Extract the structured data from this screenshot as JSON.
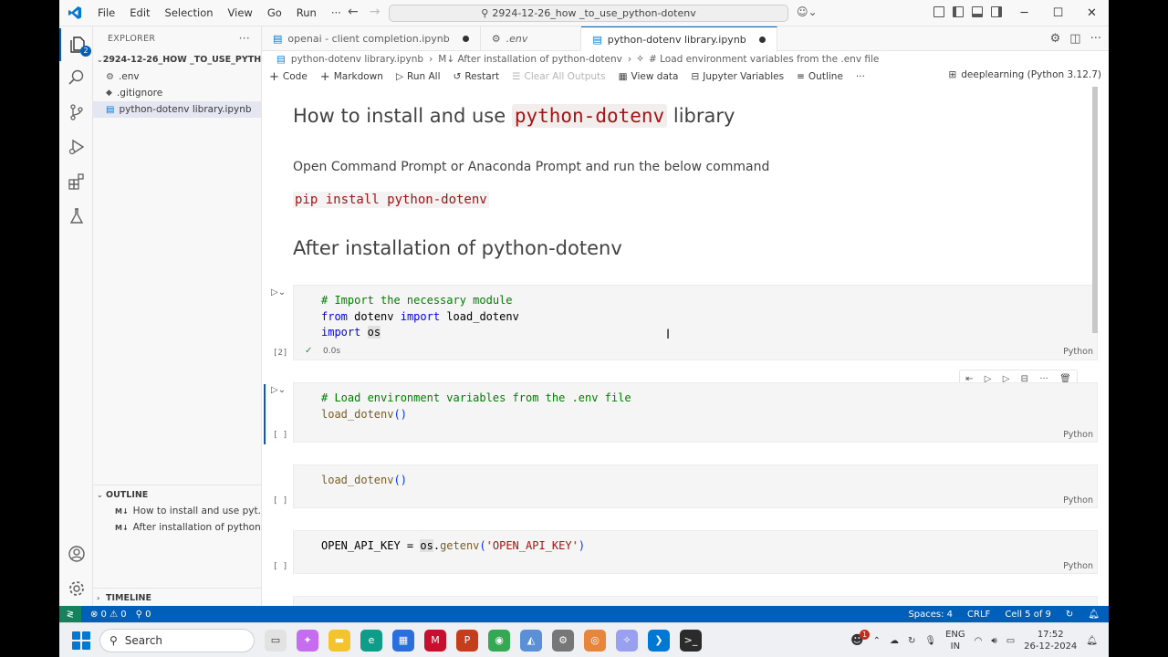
{
  "menu": [
    "File",
    "Edit",
    "Selection",
    "View",
    "Go",
    "Run",
    "···"
  ],
  "command_center": "2924-12-26_how _to_use_python-dotenv",
  "window_controls": [
    "─",
    "☐",
    "✕"
  ],
  "activity_badge": "2",
  "sidebar": {
    "explorer_label": "EXPLORER",
    "more": "···",
    "folder_name": "2924-12-26_HOW _TO_USE_PYTHON-...",
    "files": [
      {
        "name": ".env",
        "icon": "gear-icon"
      },
      {
        "name": ".gitignore",
        "icon": "diamond-icon"
      },
      {
        "name": "python-dotenv library.ipynb",
        "icon": "notebook-icon"
      }
    ],
    "outline_label": "OUTLINE",
    "outline_items": [
      "How to install and use pyt...",
      "After installation of python..."
    ],
    "timeline_label": "TIMELINE"
  },
  "tabs": [
    {
      "label": "openai - client completion.ipynb",
      "dirty": true
    },
    {
      "label": ".env",
      "dirty": false
    },
    {
      "label": "python-dotenv library.ipynb",
      "dirty": true
    }
  ],
  "breadcrumb": [
    "python-dotenv library.ipynb",
    "M↓ After installation of python-dotenv",
    "# Load environment variables from the .env file"
  ],
  "toolbar": {
    "code": "Code",
    "markdown": "Markdown",
    "run_all": "Run All",
    "restart": "Restart",
    "clear_all_outputs": "Clear All Outputs",
    "view_data": "View data",
    "jupyter_variables": "Jupyter Variables",
    "outline": "Outline",
    "more": "···",
    "kernel": "deeplearning (Python 3.12.7)"
  },
  "notebook": {
    "h1_pre": "How to install and use ",
    "h1_code": "python-dotenv",
    "h1_post": " library",
    "para": "Open Command Prompt or Anaconda Prompt and run the below command",
    "pip_cmd": "pip install python-dotenv",
    "h2": "After installation of python-dotenv",
    "cells": [
      {
        "exec": "[2]",
        "lang": "Python",
        "time": "0.0s"
      },
      {
        "exec": "[ ]",
        "lang": "Python"
      },
      {
        "exec": "[ ]",
        "lang": "Python"
      },
      {
        "exec": "[ ]",
        "lang": "Python"
      }
    ],
    "code1": {
      "comment": "# Import the necessary module",
      "from": "from",
      "mod": "dotenv",
      "import": "import",
      "fn": "load_dotenv",
      "import2": "import",
      "os": "os"
    },
    "code2": {
      "comment": "# Load environment variables from the .env file",
      "call": "load_dotenv",
      "parens": "()"
    },
    "code3": {
      "call": "load_dotenv",
      "parens": "()"
    },
    "code4": {
      "lhs": "OPEN_API_KEY = ",
      "os": "os",
      "dot": ".",
      "fn": "getenv",
      "open": "(",
      "arg": "'OPEN_API_KEY'",
      "close": ")"
    }
  },
  "statusbar": {
    "errors": "⊗ 0 ⚠ 0",
    "ports": "⚲ 0",
    "spaces": "Spaces: 4",
    "eol": "CRLF",
    "cell": "Cell 5 of 9"
  },
  "taskbar": {
    "search": "Search",
    "lang": "ENG",
    "region": "IN",
    "time": "17:52",
    "date": "26-12-2024",
    "notif_badge": "1"
  }
}
